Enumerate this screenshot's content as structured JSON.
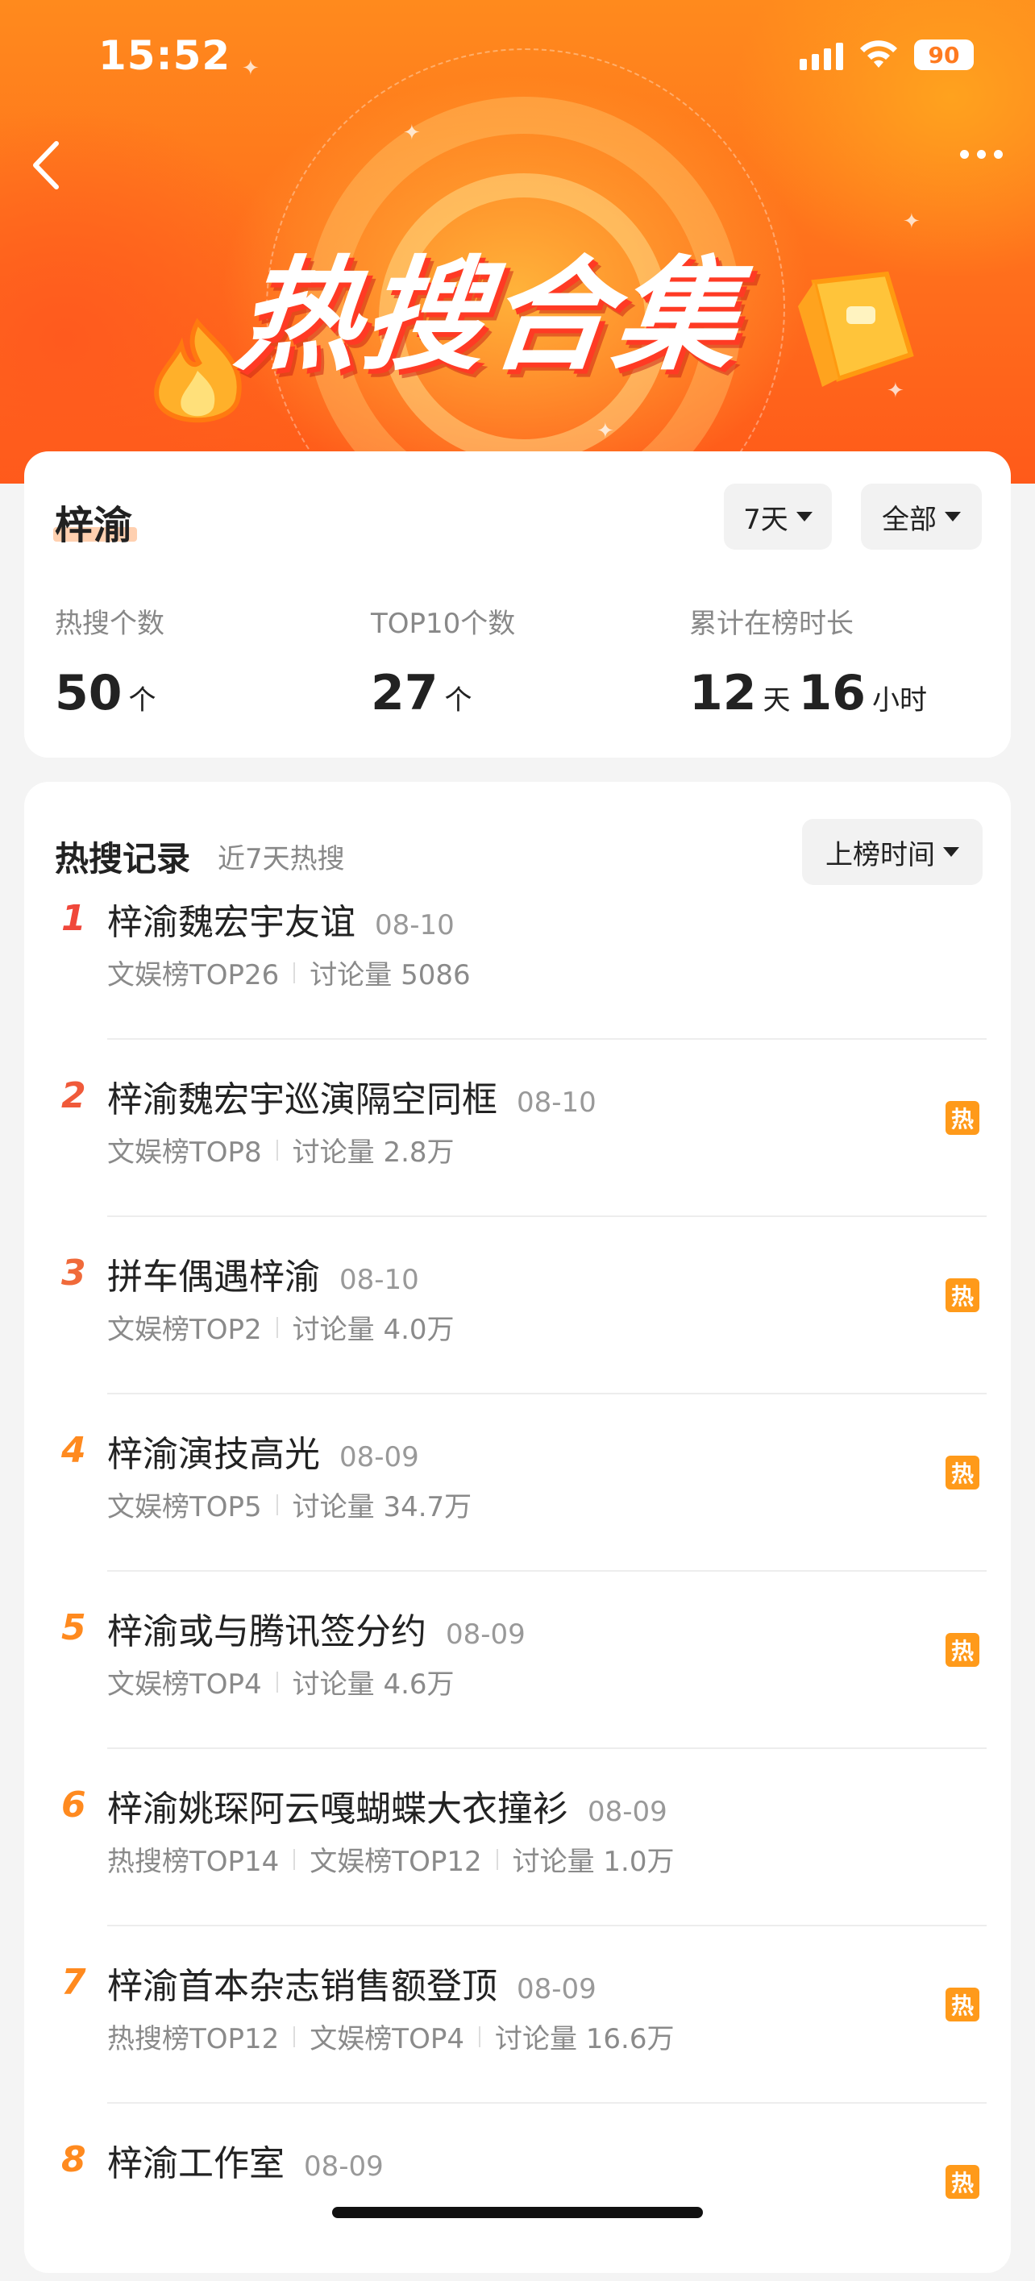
{
  "status_bar": {
    "time": "15:52",
    "battery": "90"
  },
  "header": {
    "title": "热搜合集"
  },
  "summary": {
    "name": "梓渝",
    "filter_days": "7天",
    "filter_scope": "全部",
    "stats": [
      {
        "label": "热搜个数",
        "value": "50",
        "unit": "个"
      },
      {
        "label": "TOP10个数",
        "value": "27",
        "unit": "个"
      },
      {
        "label": "累计在榜时长",
        "days": "12",
        "days_unit": "天",
        "hours": "16",
        "hours_unit": "小时"
      }
    ]
  },
  "records": {
    "title": "热搜记录",
    "subtitle": "近7天热搜",
    "sort_label": "上榜时间",
    "hot_label": "热",
    "items": [
      {
        "rank": "1",
        "title": "梓渝魏宏宇友谊",
        "date": "08-10",
        "meta": [
          "文娱榜TOP26",
          "讨论量 5086"
        ],
        "hot": false,
        "rank_color": "#f0473a"
      },
      {
        "rank": "2",
        "title": "梓渝魏宏宇巡演隔空同框",
        "date": "08-10",
        "meta": [
          "文娱榜TOP8",
          "讨论量 2.8万"
        ],
        "hot": true,
        "rank_color": "#f05a3a"
      },
      {
        "rank": "3",
        "title": "拼车偶遇梓渝",
        "date": "08-10",
        "meta": [
          "文娱榜TOP2",
          "讨论量 4.0万"
        ],
        "hot": true,
        "rank_color": "#f06a3a"
      },
      {
        "rank": "4",
        "title": "梓渝演技高光",
        "date": "08-09",
        "meta": [
          "文娱榜TOP5",
          "讨论量 34.7万"
        ],
        "hot": true,
        "rank_color": "#ff8a1f"
      },
      {
        "rank": "5",
        "title": "梓渝或与腾讯签分约",
        "date": "08-09",
        "meta": [
          "文娱榜TOP4",
          "讨论量 4.6万"
        ],
        "hot": true,
        "rank_color": "#ff8a1f"
      },
      {
        "rank": "6",
        "title": "梓渝姚琛阿云嘎蝴蝶大衣撞衫",
        "date": "08-09",
        "meta": [
          "热搜榜TOP14",
          "文娱榜TOP12",
          "讨论量 1.0万"
        ],
        "hot": false,
        "rank_color": "#ff8a1f"
      },
      {
        "rank": "7",
        "title": "梓渝首本杂志销售额登顶",
        "date": "08-09",
        "meta": [
          "热搜榜TOP12",
          "文娱榜TOP4",
          "讨论量 16.6万"
        ],
        "hot": true,
        "rank_color": "#ff8a1f"
      },
      {
        "rank": "8",
        "title": "梓渝工作室",
        "date": "08-09",
        "meta": [],
        "hot": true,
        "rank_color": "#ff8a1f"
      }
    ]
  }
}
